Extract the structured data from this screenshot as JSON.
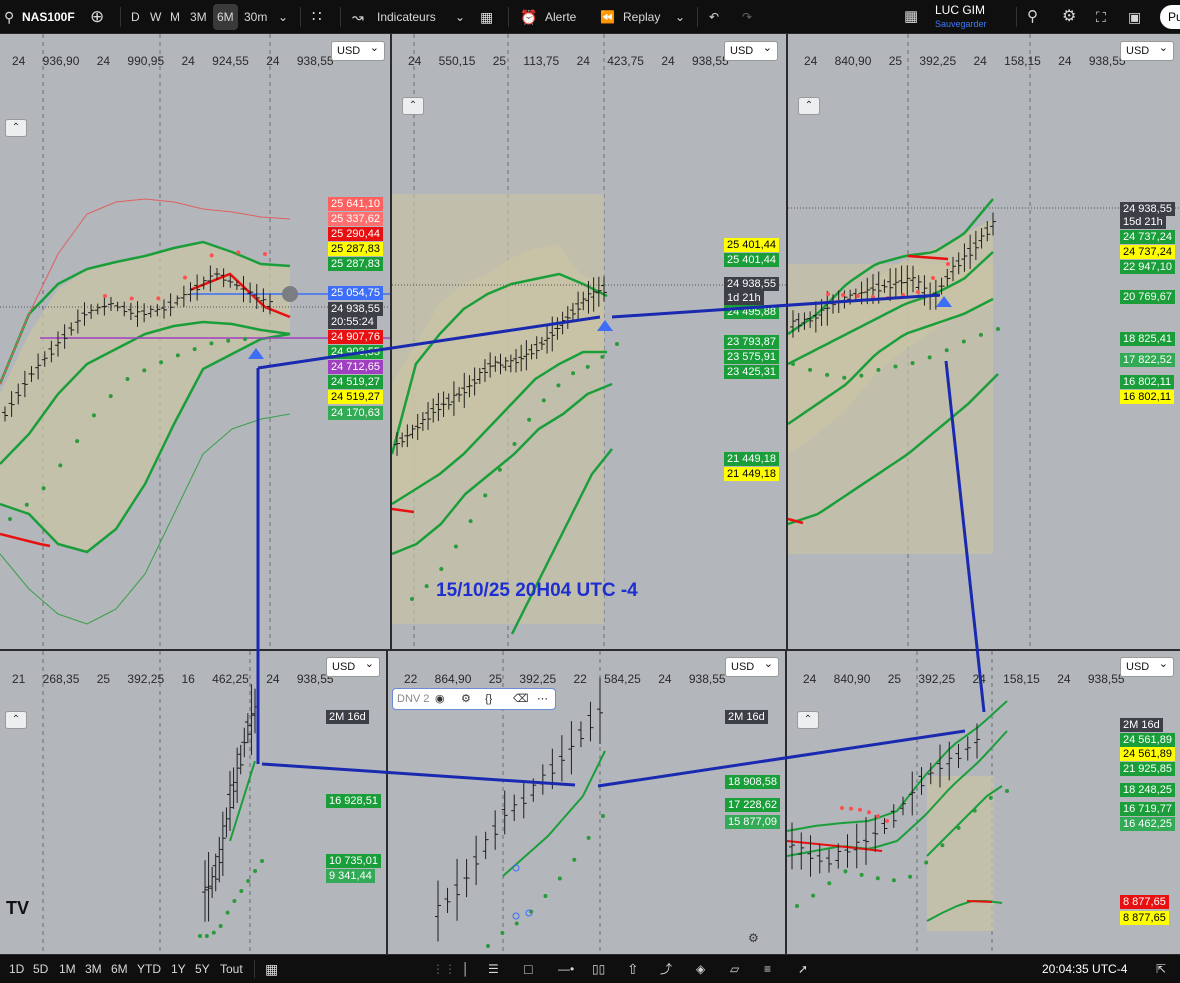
{
  "topbar": {
    "symbol": "NAS100F",
    "intervals": [
      "D",
      "W",
      "M",
      "3M",
      "6M",
      "30m"
    ],
    "indicators": "Indicateurs",
    "alert": "Alerte",
    "replay": "Replay",
    "user": "LUC GIM",
    "save": "Sauvegarder",
    "publish": "Pu"
  },
  "bottombar": {
    "ranges": [
      "1D",
      "5D",
      "1M",
      "3M",
      "6M",
      "YTD",
      "1Y",
      "5Y",
      "Tout"
    ],
    "clock": "20:04:35 UTC-4"
  },
  "annotation": "15/10/25 20H04 UTC -4",
  "currency": "USD",
  "dnv_label": "DNV 2",
  "colors": {
    "green": "#1a9e3a",
    "red": "#ff4d4d",
    "dark": "#3d3f46",
    "yellow": "#ffff00",
    "blue": "#3d6ef7",
    "purple": "#a040c0",
    "band": "#c9c4a4"
  },
  "panes": [
    {
      "ohlc": [
        "24 936,90",
        "24 990,95",
        "24 924,55",
        "24 938,55"
      ],
      "labels": [
        {
          "t": "25 641,10",
          "c": "#ff6060"
        },
        {
          "t": "25 337,62",
          "c": "#ff7070"
        },
        {
          "t": "25 290,44",
          "c": "#e81010"
        },
        {
          "t": "25 287,83",
          "c": "#ffff00"
        },
        {
          "t": "25 287,83",
          "c": "#1a9e3a"
        },
        {
          "t": "25 054,75",
          "c": "#3d6ef7"
        },
        {
          "t": "24 938,55",
          "c": "#3d3f46"
        },
        {
          "t": "20:55:24",
          "c": "#3d3f46"
        },
        {
          "t": "24 907,76",
          "c": "#e81010"
        },
        {
          "t": "24 903,55",
          "c": "#1a9e3a"
        },
        {
          "t": "24 712,65",
          "c": "#a040c0"
        },
        {
          "t": "24 519,27",
          "c": "#1a9e3a"
        },
        {
          "t": "24 519,27",
          "c": "#ffff00"
        },
        {
          "t": "24 170,63",
          "c": "#33aa55"
        }
      ]
    },
    {
      "ohlc": [
        "24 550,15",
        "25 113,75",
        "24 423,75",
        "24 938,55"
      ],
      "labels": [
        {
          "t": "25 401,44",
          "c": "#ffff00"
        },
        {
          "t": "25 401,44",
          "c": "#1a9e3a"
        },
        {
          "t": "24 938,55",
          "c": "#3d3f46"
        },
        {
          "t": "1d 21h",
          "c": "#3d3f46"
        },
        {
          "t": "24 495,88",
          "c": "#1a9e3a"
        },
        {
          "t": "23 793,87",
          "c": "#1a9e3a"
        },
        {
          "t": "23 575,91",
          "c": "#1a9e3a"
        },
        {
          "t": "23 425,31",
          "c": "#1a9e3a"
        },
        {
          "t": "21 449,18",
          "c": "#1a9e3a"
        },
        {
          "t": "21 449,18",
          "c": "#ffff00"
        }
      ]
    },
    {
      "ohlc": [
        "24 840,90",
        "25 392,25",
        "24 158,15",
        "24 938,55"
      ],
      "labels": [
        {
          "t": "24 938,55",
          "c": "#3d3f46"
        },
        {
          "t": "15d 21h",
          "c": "#3d3f46"
        },
        {
          "t": "24 737,24",
          "c": "#1a9e3a"
        },
        {
          "t": "24 737,24",
          "c": "#ffff00"
        },
        {
          "t": "22 947,10",
          "c": "#1a9e3a"
        },
        {
          "t": "20 769,67",
          "c": "#1a9e3a"
        },
        {
          "t": "18 825,41",
          "c": "#1a9e3a"
        },
        {
          "t": "17 822,52",
          "c": "#33aa55"
        },
        {
          "t": "16 802,11",
          "c": "#1a9e3a"
        },
        {
          "t": "16 802,11",
          "c": "#ffff00"
        }
      ]
    },
    {
      "ohlc": [
        "21 268,35",
        "25 392,25",
        "16 462,25",
        "24 938,55"
      ],
      "labels": [
        {
          "t": "2M 16d",
          "c": "#3d3f46"
        },
        {
          "t": "16 928,51",
          "c": "#1a9e3a"
        },
        {
          "t": "10 735,01",
          "c": "#1a9e3a"
        },
        {
          "t": "9 341,44",
          "c": "#33aa55"
        }
      ]
    },
    {
      "ohlc": [
        "22 864,90",
        "25 392,25",
        "22 584,25",
        "24 938,55"
      ],
      "labels": [
        {
          "t": "2M 16d",
          "c": "#3d3f46"
        },
        {
          "t": "18 908,58",
          "c": "#1a9e3a"
        },
        {
          "t": "17 228,62",
          "c": "#1a9e3a"
        },
        {
          "t": "15 877,09",
          "c": "#33aa55"
        }
      ]
    },
    {
      "ohlc": [
        "24 840,90",
        "25 392,25",
        "24 158,15",
        "24 938,55"
      ],
      "labels": [
        {
          "t": "2M 16d",
          "c": "#3d3f46"
        },
        {
          "t": "24 561,89",
          "c": "#1a9e3a"
        },
        {
          "t": "24 561,89",
          "c": "#ffff00"
        },
        {
          "t": "21 925,85",
          "c": "#1a9e3a"
        },
        {
          "t": "18 248,25",
          "c": "#1a9e3a"
        },
        {
          "t": "16 719,77",
          "c": "#1a9e3a"
        },
        {
          "t": "16 462,25",
          "c": "#33aa55"
        },
        {
          "t": "8 877,65",
          "c": "#e81010"
        },
        {
          "t": "8 877,65",
          "c": "#ffff00"
        }
      ]
    }
  ]
}
